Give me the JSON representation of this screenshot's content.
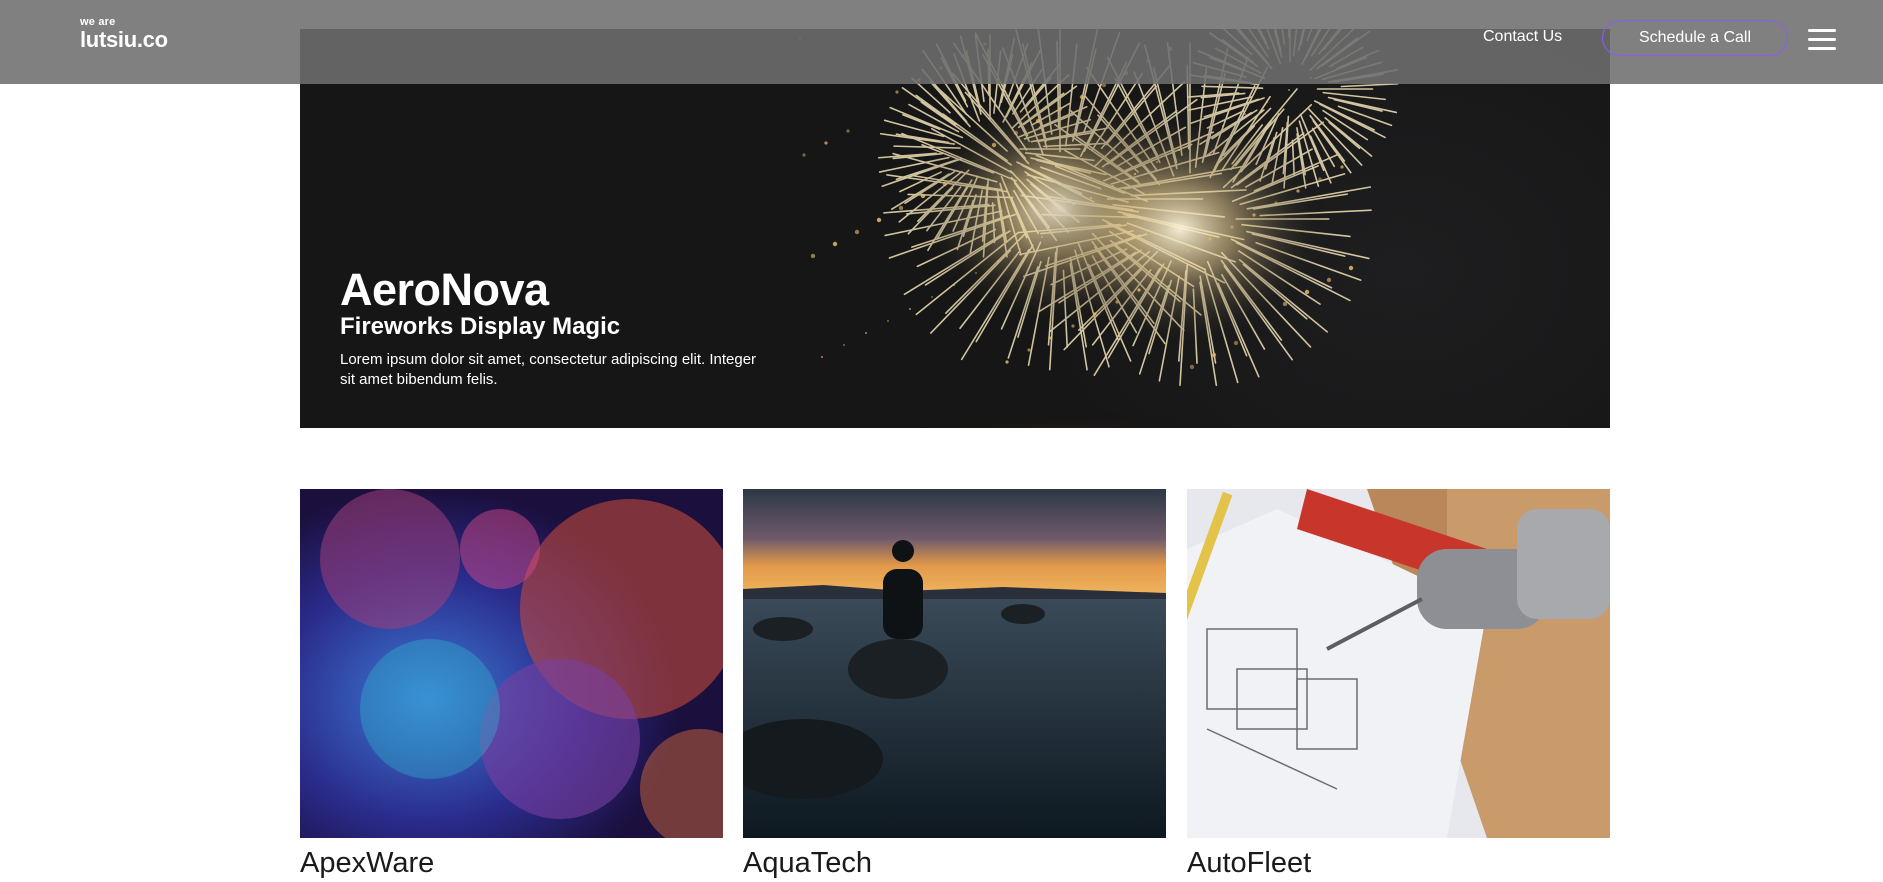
{
  "header": {
    "logo_small": "we are",
    "logo_big": "lutsiu.co",
    "contact_label": "Contact Us",
    "cta_label": "Schedule a Call",
    "menu_icon": "hamburger-icon"
  },
  "hero": {
    "title": "AeroNova",
    "subtitle": "Fireworks Display Magic",
    "description": "Lorem ipsum dolor sit amet, consectetur adipiscing elit. Integer sit amet bibendum felis."
  },
  "cards": [
    {
      "title": "ApexWare"
    },
    {
      "title": "AquaTech"
    },
    {
      "title": "AutoFleet"
    }
  ],
  "colors": {
    "header_bg": "#6e6e6e",
    "cta_border": "#8b5cf6",
    "hero_bg": "#161616"
  }
}
